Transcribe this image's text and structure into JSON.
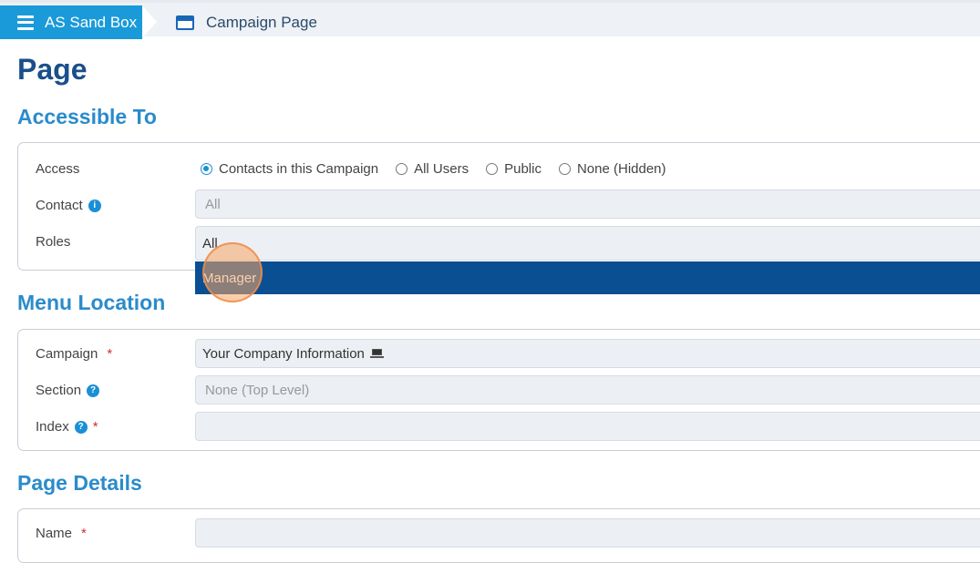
{
  "header": {
    "app_name": "AS Sand Box",
    "page_name": "Campaign Page"
  },
  "page": {
    "title": "Page"
  },
  "accessible_to": {
    "title": "Accessible To",
    "access_label": "Access",
    "access_options": [
      "Contacts in this Campaign",
      "All Users",
      "Public",
      "None (Hidden)"
    ],
    "access_selected": "Contacts in this Campaign",
    "contact_label": "Contact",
    "contact_placeholder": "All",
    "roles_label": "Roles",
    "roles_value": "All",
    "roles_dropdown_option": "Manager"
  },
  "menu_location": {
    "title": "Menu Location",
    "campaign_label": "Campaign",
    "campaign_value": "Your Company Information",
    "section_label": "Section",
    "section_placeholder": "None (Top Level)",
    "index_label": "Index",
    "index_value": ""
  },
  "page_details": {
    "title": "Page Details",
    "name_label": "Name",
    "name_value": ""
  },
  "icons": {
    "menu": "hamburger-icon",
    "page": "page-icon",
    "info": "info-icon",
    "help": "help-icon",
    "laptop": "laptop-icon"
  },
  "colors": {
    "brand": "#1a9ad9",
    "heading": "#1a4f8a",
    "section": "#2b8bcb",
    "dropdown_highlight": "#0a4f92",
    "required": "#d32f2f"
  }
}
